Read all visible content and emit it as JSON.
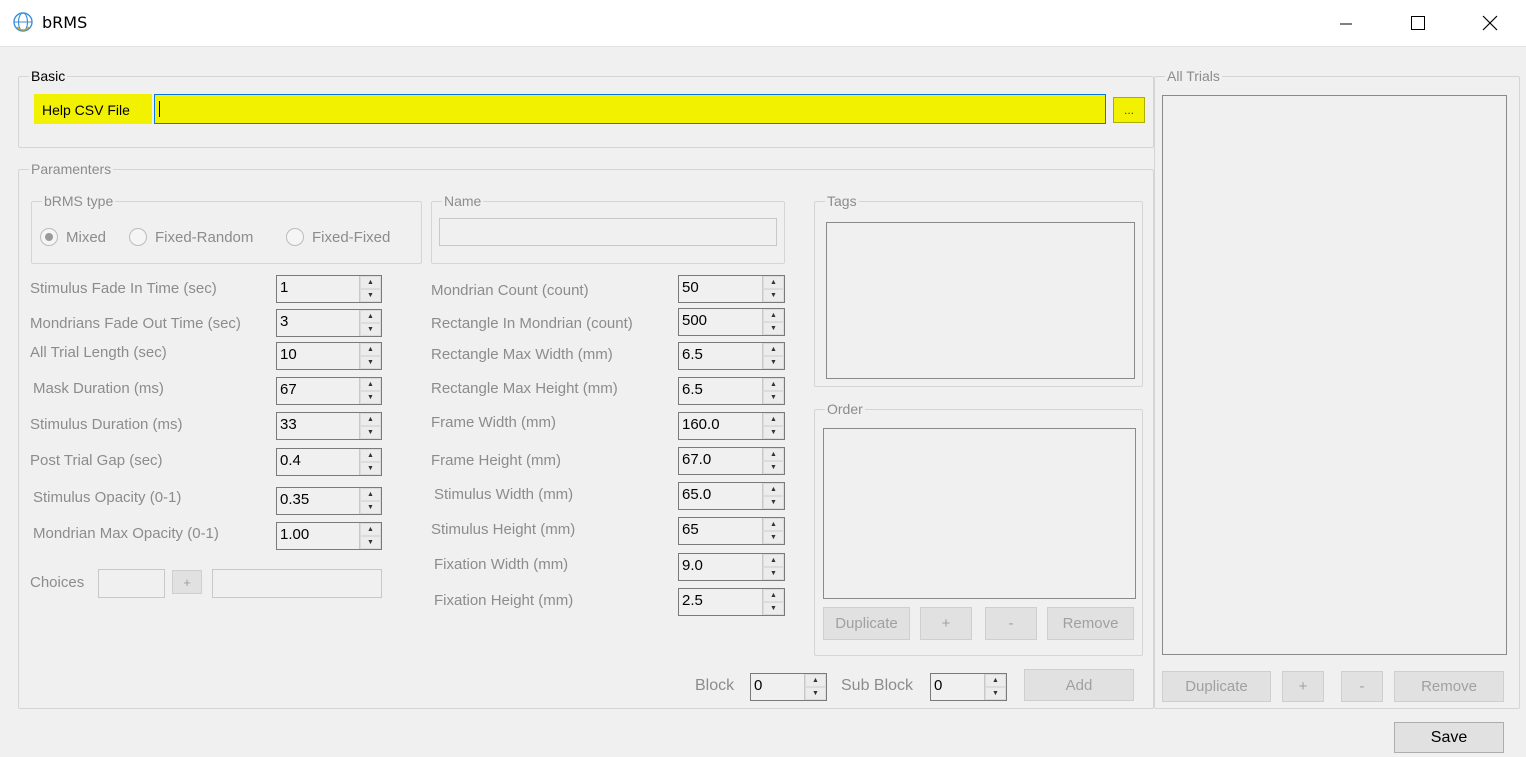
{
  "window": {
    "title": "bRMS",
    "icon": "app-globe-icon",
    "minimize_icon": "minimize-icon",
    "maximize_icon": "maximize-icon",
    "close_icon": "close-icon"
  },
  "basic": {
    "group_title": "Basic",
    "help_csv_label": "Help CSV File",
    "help_csv_value": "",
    "browse_label": "...",
    "highlight_color": "#f2f200"
  },
  "parameters": {
    "group_title": "Paramenters",
    "brms_type": {
      "title": "bRMS type",
      "options": [
        "Mixed",
        "Fixed-Random",
        "Fixed-Fixed"
      ],
      "selected": "Mixed"
    },
    "name": {
      "title": "Name",
      "value": ""
    },
    "left_fields": [
      {
        "label": "Stimulus Fade In Time (sec)",
        "value": "1"
      },
      {
        "label": "Mondrians Fade Out Time (sec)",
        "value": "3"
      },
      {
        "label": "All Trial Length (sec)",
        "value": "10"
      },
      {
        "label": "Mask Duration (ms)",
        "value": "67"
      },
      {
        "label": "Stimulus Duration (ms)",
        "value": "33"
      },
      {
        "label": "Post Trial Gap (sec)",
        "value": "0.4"
      },
      {
        "label": "Stimulus Opacity (0-1)",
        "value": "0.35"
      },
      {
        "label": "Mondrian Max Opacity (0-1)",
        "value": "1.00"
      }
    ],
    "right_fields": [
      {
        "label": "Mondrian Count (count)",
        "value": "50"
      },
      {
        "label": "Rectangle In Mondrian (count)",
        "value": "500"
      },
      {
        "label": "Rectangle Max Width (mm)",
        "value": "6.5"
      },
      {
        "label": "Rectangle Max Height (mm)",
        "value": "6.5"
      },
      {
        "label": "Frame Width (mm)",
        "value": "160.0"
      },
      {
        "label": "Frame Height (mm)",
        "value": "67.0"
      },
      {
        "label": "Stimulus Width (mm)",
        "value": "65.0"
      },
      {
        "label": "Stimulus Height (mm)",
        "value": "65"
      },
      {
        "label": "Fixation Width (mm)",
        "value": "9.0"
      },
      {
        "label": "Fixation Height (mm)",
        "value": "2.5"
      }
    ],
    "choices": {
      "label": "Choices",
      "add_label": "+"
    },
    "tags": {
      "title": "Tags"
    },
    "order": {
      "title": "Order",
      "duplicate_label": "Duplicate",
      "plus_label": "+",
      "minus_label": "-",
      "remove_label": "Remove"
    },
    "block": {
      "label": "Block",
      "value": "0"
    },
    "sub_block": {
      "label": "Sub Block",
      "value": "0"
    },
    "add_label": "Add"
  },
  "all_trials": {
    "title": "All Trials",
    "duplicate_label": "Duplicate",
    "plus_label": "+",
    "minus_label": "-",
    "remove_label": "Remove"
  },
  "save_label": "Save"
}
